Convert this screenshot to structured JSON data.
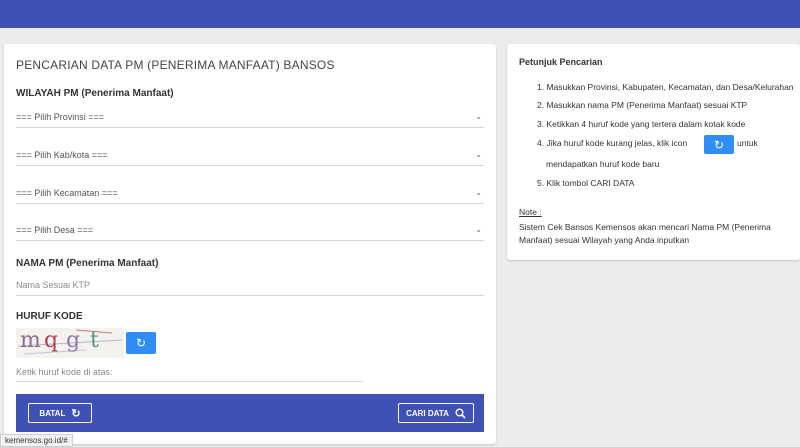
{
  "title": "PENCARIAN DATA PM (PENERIMA MANFAAT) BANSOS",
  "wilayah": {
    "label": "WILAYAH PM (Penerima Manfaat)",
    "provinsi": "=== Pilih Provinsi ===",
    "kabkota": "=== Pilih Kab/kota ===",
    "kecamatan": "=== Pilih Kecamatan ===",
    "desa": "=== Pilih Desa ==="
  },
  "nama": {
    "label": "NAMA PM (Penerima Manfaat)",
    "placeholder": "Nama Sesuai KTP"
  },
  "kode": {
    "label": "HURUF KODE",
    "captcha_text": "mqgt",
    "placeholder": "Ketik huruf kode di atas:"
  },
  "buttons": {
    "batal": "BATAL",
    "cari": "CARI DATA"
  },
  "petunjuk": {
    "title": "Petunjuk Pencarian",
    "steps": [
      "1. Masukkan Provinsi, Kabupaten, Kecamatan, dan Desa/Kelurahan",
      "2. Masukkan nama PM (Penerima Manfaat) sesuai KTP",
      "3. Ketikkan 4 huruf kode yang tertera dalam kotak kode",
      "4. Jika huruf kode kurang jelas, klik icon",
      "untuk",
      "mendapatkan huruf kode baru",
      "5. Klik tombol CARI DATA"
    ],
    "note_label": "Note :",
    "note_text": "Sistem Cek Bansos Kemensos akan mencari Nama PM (Penerima Manfaat) sesuai Wilayah yang Anda inputkan"
  },
  "status_url": "kemensos.go.id/#",
  "colors": {
    "primary": "#4051b5",
    "accent": "#2f8ef4",
    "background": "#ececec"
  },
  "icons": {
    "refresh": "refresh-icon",
    "search": "search-icon",
    "chevron": "chevron-down-icon"
  }
}
